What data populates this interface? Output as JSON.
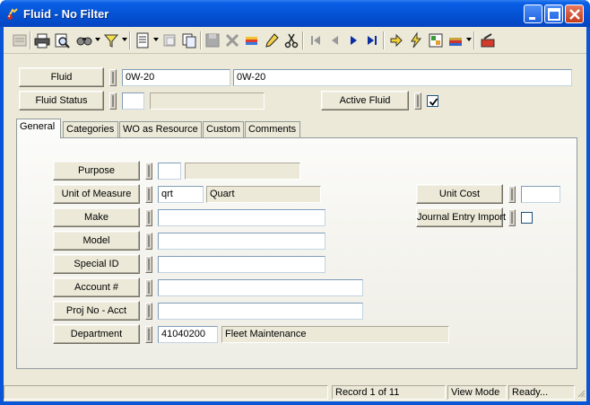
{
  "window": {
    "title": "Fluid - No Filter"
  },
  "header": {
    "fluid_label": "Fluid",
    "fluid_code": "0W-20",
    "fluid_description": "0W-20",
    "fluid_status_label": "Fluid Status",
    "fluid_status_code": "",
    "fluid_status_description": "",
    "active_fluid_label": "Active Fluid",
    "active_fluid_checked": true
  },
  "tabs": [
    {
      "label": "General",
      "active": true
    },
    {
      "label": "Categories"
    },
    {
      "label": "WO as Resource"
    },
    {
      "label": "Custom"
    },
    {
      "label": "Comments"
    }
  ],
  "general": {
    "purpose_label": "Purpose",
    "purpose_code": "",
    "purpose_description": "",
    "uom_label": "Unit of Measure",
    "uom_code": "qrt",
    "uom_description": "Quart",
    "make_label": "Make",
    "make_value": "",
    "model_label": "Model",
    "model_value": "",
    "special_id_label": "Special ID",
    "special_id_value": "",
    "account_label": "Account #",
    "account_value": "",
    "proj_label": "Proj No - Acct",
    "proj_value": "",
    "department_label": "Department",
    "department_code": "41040200",
    "department_description": "Fleet Maintenance",
    "unit_cost_label": "Unit Cost",
    "unit_cost_value": "",
    "journal_label": "Journal Entry Import",
    "journal_checked": false
  },
  "status": {
    "record": "Record 1 of 11",
    "mode": "View Mode",
    "state": "Ready..."
  }
}
